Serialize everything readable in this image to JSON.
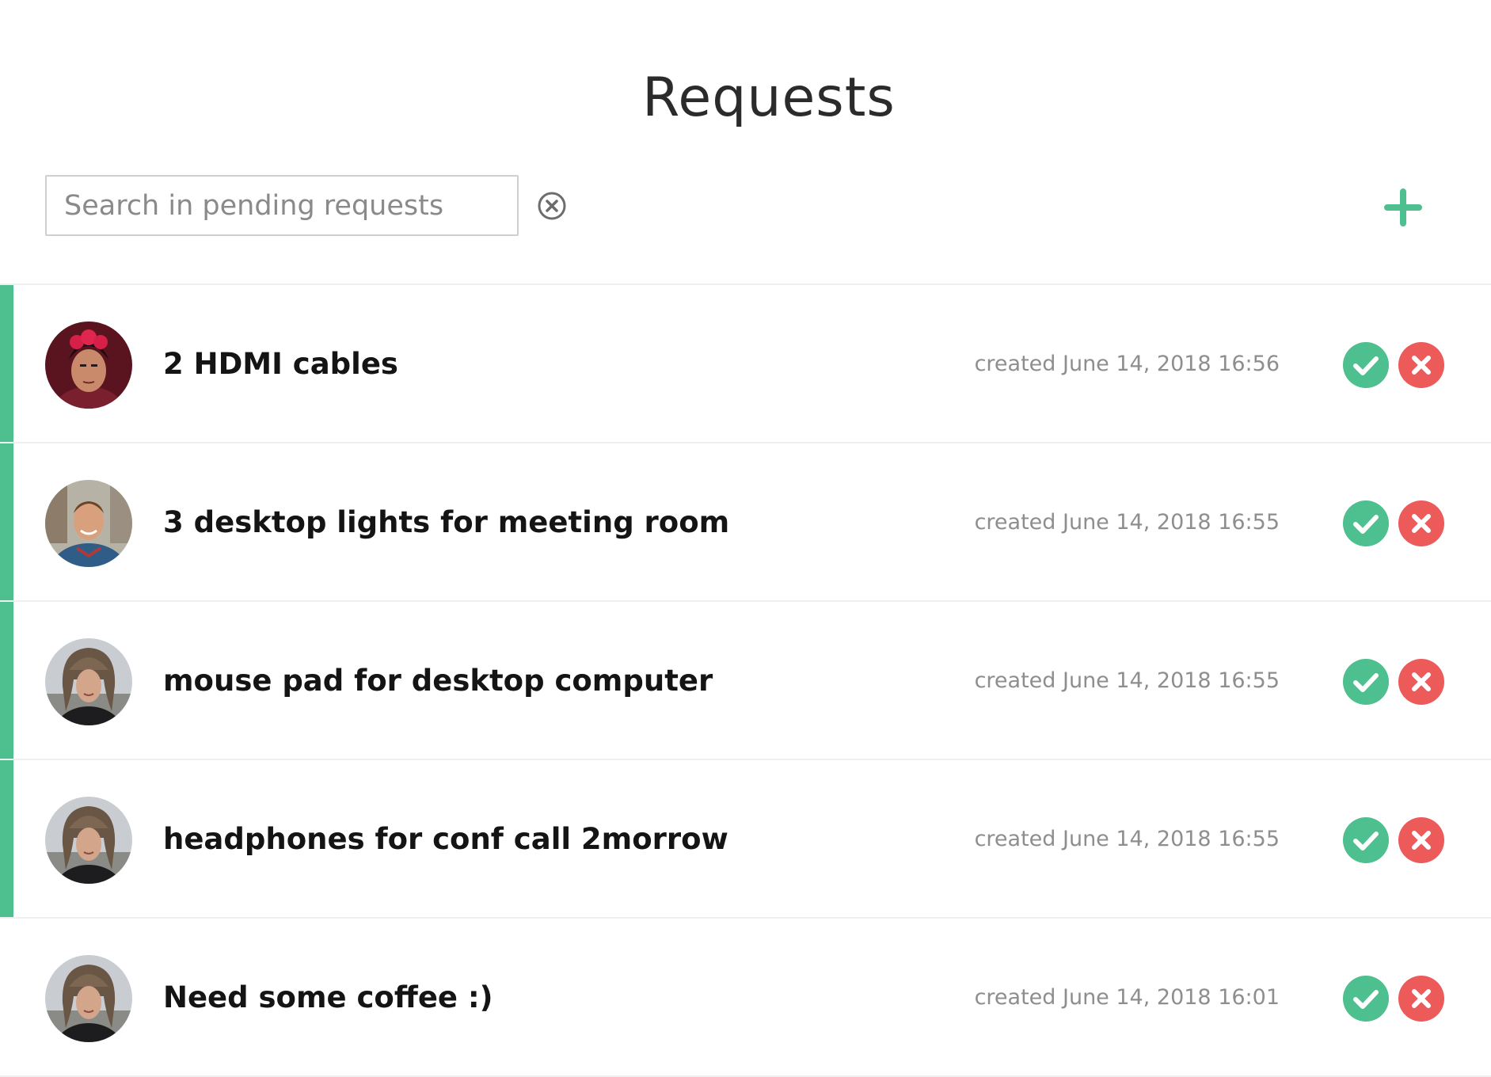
{
  "page": {
    "title": "Requests"
  },
  "search": {
    "placeholder": "Search in pending requests",
    "value": ""
  },
  "icons": {
    "clear": "close-circle-icon",
    "add": "plus-icon",
    "approve": "checkmark-icon",
    "reject": "close-x-icon"
  },
  "colors": {
    "accent": "#4ebf8e",
    "approve": "#4ebf8e",
    "reject": "#ec5a5a",
    "text": "#141414",
    "muted": "#8e8e8e"
  },
  "requests": [
    {
      "title": "2 HDMI cables",
      "created": "created June 14, 2018 16:56",
      "pending": true,
      "avatar": "woman-red-flower-crown"
    },
    {
      "title": "3 desktop lights for meeting room",
      "created": "created June 14, 2018 16:55",
      "pending": true,
      "avatar": "man-smiling-blue-sweater"
    },
    {
      "title": "mouse pad for desktop computer",
      "created": "created June 14, 2018 16:55",
      "pending": true,
      "avatar": "woman-fur-hat"
    },
    {
      "title": "headphones for conf call 2morrow",
      "created": "created June 14, 2018 16:55",
      "pending": true,
      "avatar": "woman-fur-hat"
    },
    {
      "title": "Need some coffee :)",
      "created": "created June 14, 2018 16:01",
      "pending": false,
      "avatar": "woman-fur-hat"
    }
  ]
}
